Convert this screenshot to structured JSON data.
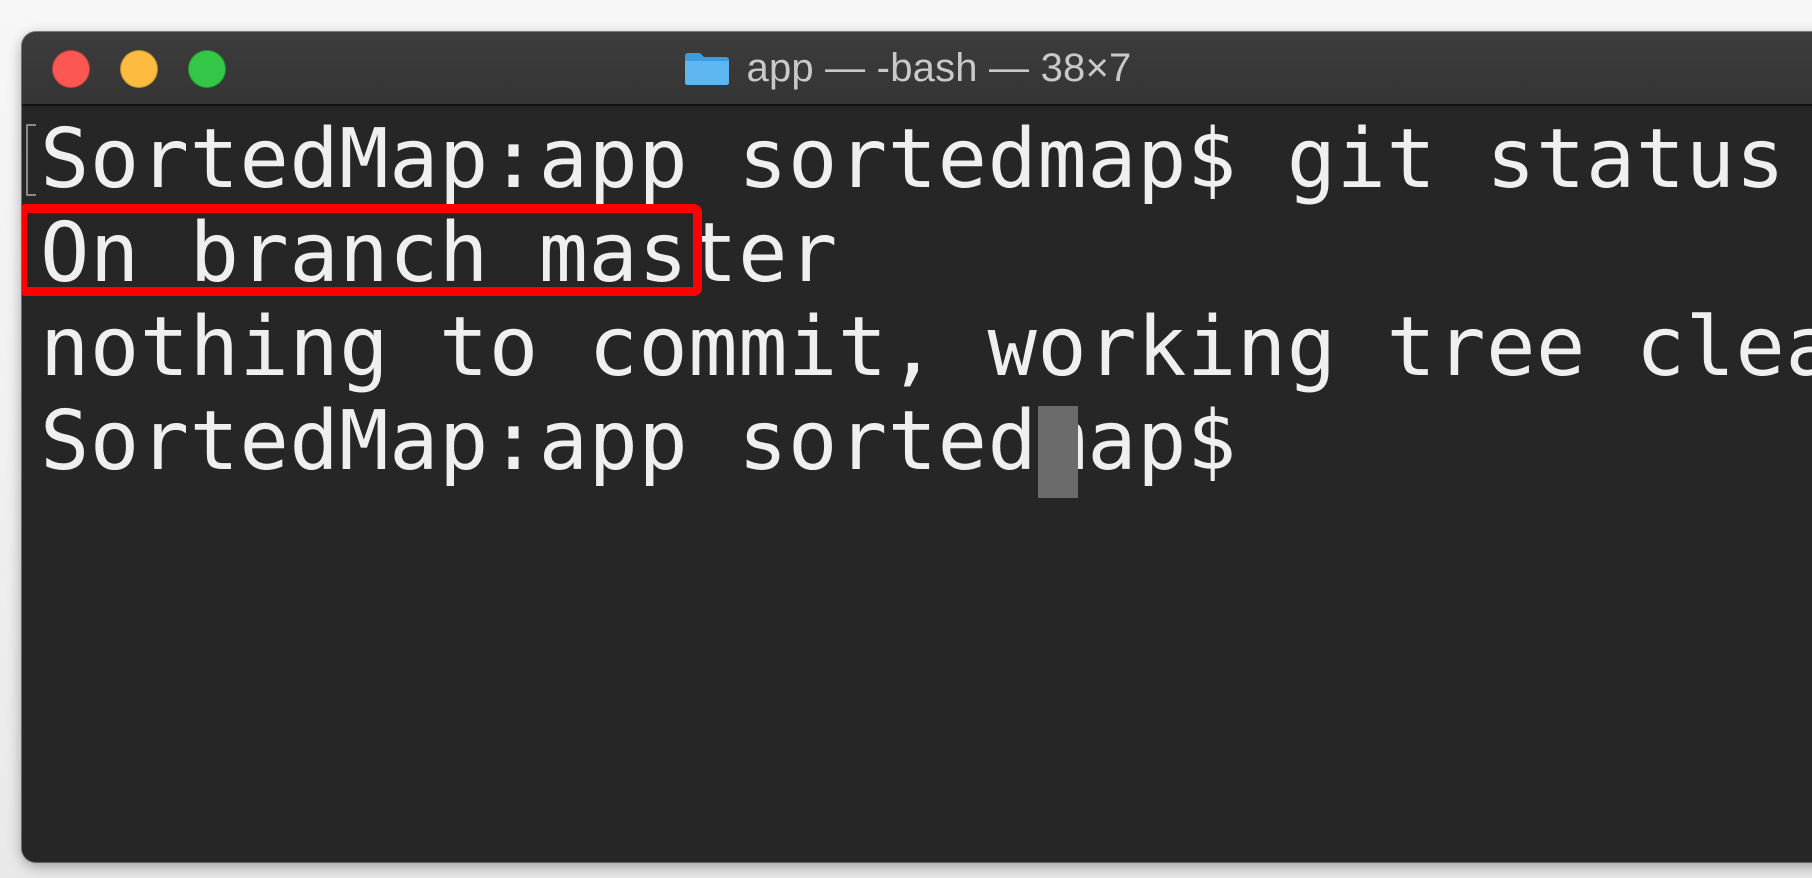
{
  "window": {
    "title": "app — -bash — 38×7",
    "title_icon": "folder-icon",
    "traffic_lights": {
      "close_color": "#fc5753",
      "minimize_color": "#fdbc40",
      "maximize_color": "#33c748"
    }
  },
  "terminal": {
    "lines": [
      "SortedMap:app sortedmap$ git status",
      "On branch master",
      "nothing to commit, working tree clean",
      "SortedMap:app sortedmap$ "
    ],
    "highlighted_line_index": 1,
    "highlight_color": "#ff0000",
    "background": "#262626",
    "text_color": "#efefef"
  }
}
